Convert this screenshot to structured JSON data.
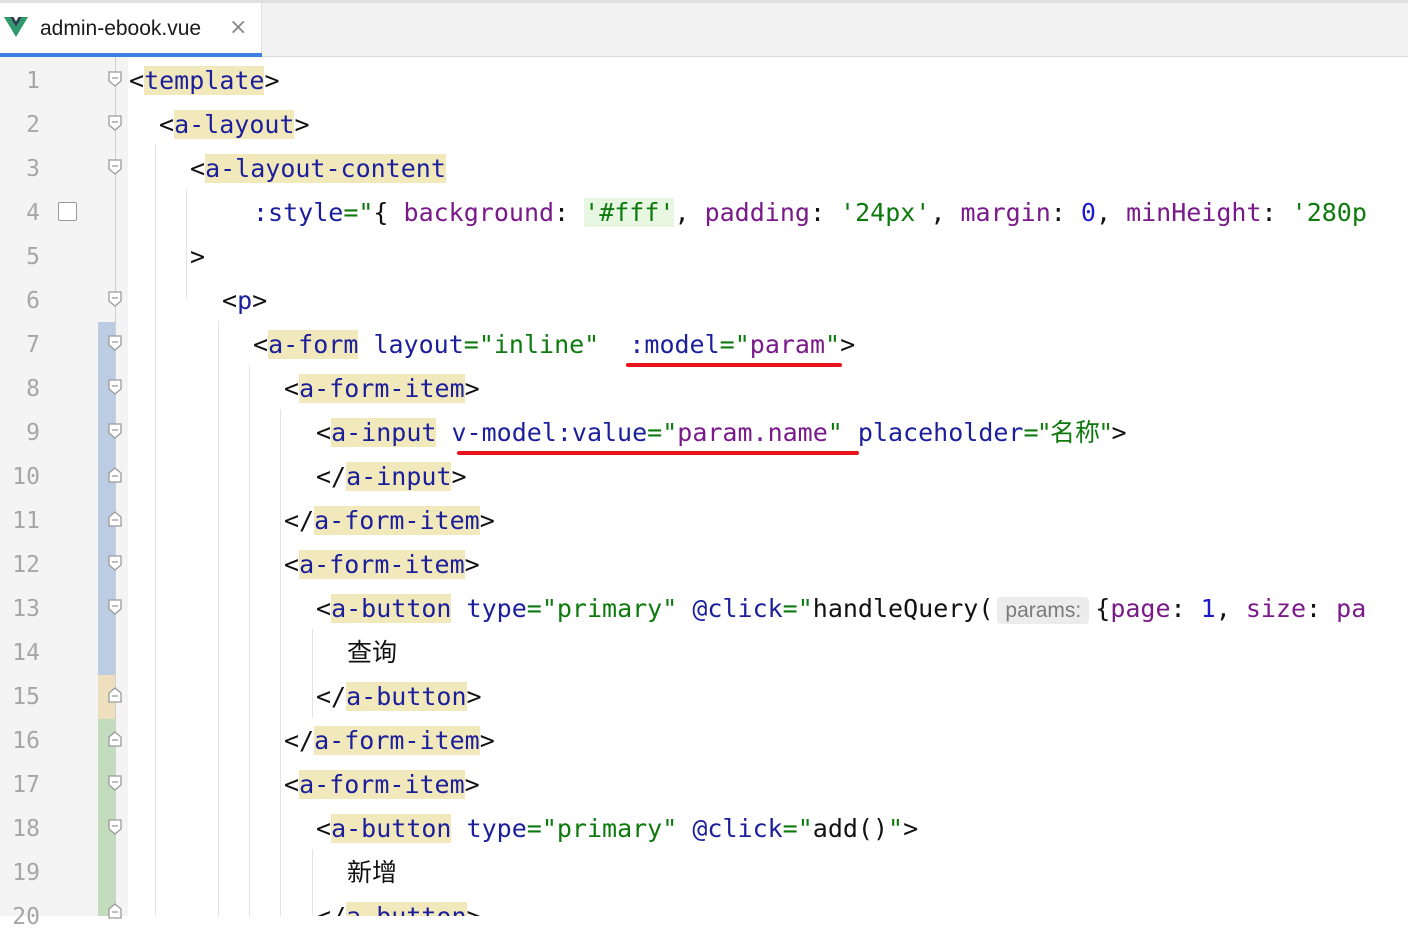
{
  "tab": {
    "title": "admin-ebook.vue",
    "icon": "vue-logo-icon",
    "close": "×",
    "accent": "#3d80e0"
  },
  "gutter": {
    "line_numbers": [
      "1",
      "2",
      "3",
      "4",
      "5",
      "6",
      "7",
      "8",
      "9",
      "10",
      "11",
      "12",
      "13",
      "14",
      "15",
      "16",
      "17",
      "18",
      "19",
      "20"
    ]
  },
  "colors": {
    "tag": "#1b1f9b",
    "tag_highlight": "#f1e8bc",
    "string": "#0e7a0e",
    "variable": "#7a1a8a",
    "number": "#1c1ccc",
    "annotation": "#e8141a"
  },
  "code": {
    "l1": {
      "open": "<",
      "tag": "template",
      "close": ">"
    },
    "l2": {
      "open": "<",
      "tag": "a-layout",
      "close": ">"
    },
    "l3": {
      "open": "<",
      "tag": "a-layout-content"
    },
    "l4": {
      "attr": ":style",
      "eq": "=\"",
      "brace": "{ ",
      "k1": "background",
      "colon": ": ",
      "v1": "'#fff'",
      "comma": ", ",
      "k2": "padding",
      "v2": "'24px'",
      "k3": "margin",
      "v3": "0",
      "k4": "minHeight",
      "v4": "'280p"
    },
    "l5": {
      "close": ">"
    },
    "l6": {
      "open": "<",
      "tag": "p",
      "close": ">"
    },
    "l7": {
      "open": "<",
      "tag": "a-form",
      "attr1": "layout",
      "val1": "\"inline\"",
      "attr2": ":model",
      "q": "\"",
      "var": "param",
      "close": ">"
    },
    "l8": {
      "open": "<",
      "tag": "a-form-item",
      "close": ">"
    },
    "l9": {
      "open": "<",
      "tag": "a-input",
      "attr1": "v-model:value",
      "var": "param.name",
      "attr2": "placeholder",
      "val2": "\"名称\"",
      "close": ">"
    },
    "l10": {
      "open": "</",
      "tag": "a-input",
      "close": ">"
    },
    "l11": {
      "open": "</",
      "tag": "a-form-item",
      "close": ">"
    },
    "l12": {
      "open": "<",
      "tag": "a-form-item",
      "close": ">"
    },
    "l13": {
      "open": "<",
      "tag": "a-button",
      "attr1": "type",
      "val1": "\"primary\"",
      "attr2": "@click",
      "fn": "handleQuery(",
      "hint": "params:",
      "brace": "{",
      "k1": "page",
      "v1": "1",
      "k2": "size",
      "v2": "pa"
    },
    "l14": {
      "text": "查询"
    },
    "l15": {
      "open": "</",
      "tag": "a-button",
      "close": ">"
    },
    "l16": {
      "open": "</",
      "tag": "a-form-item",
      "close": ">"
    },
    "l17": {
      "open": "<",
      "tag": "a-form-item",
      "close": ">"
    },
    "l18": {
      "open": "<",
      "tag": "a-button",
      "attr1": "type",
      "val1": "\"primary\"",
      "attr2": "@click",
      "fn": "add()"
    },
    "l19": {
      "text": "新增"
    },
    "l20": {
      "open": "</",
      "tag": "a-button",
      "close": ">"
    }
  }
}
